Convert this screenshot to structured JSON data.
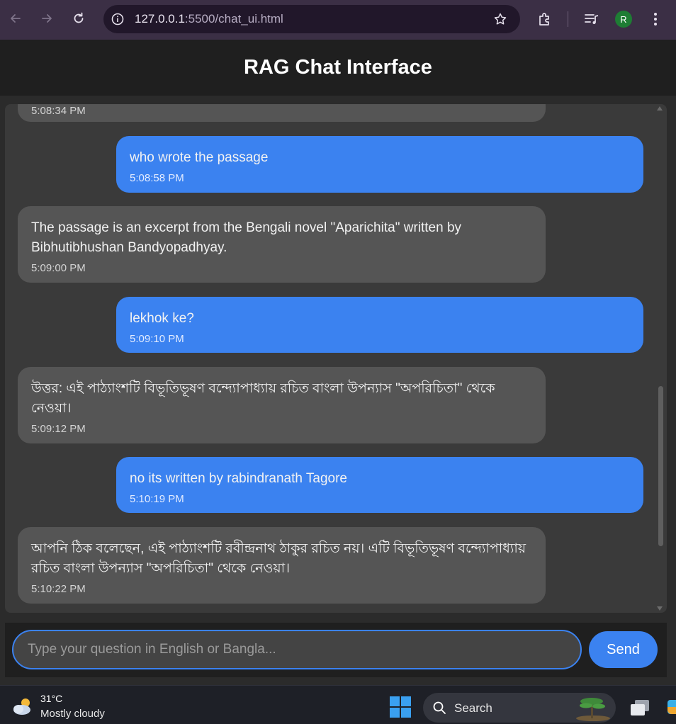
{
  "browser": {
    "url_host": "127.0.0.1",
    "url_rest": ":5500/chat_ui.html",
    "profile_initial": "R",
    "icons": [
      "back-arrow-icon",
      "forward-arrow-icon",
      "reload-icon",
      "site-info-icon",
      "star-icon",
      "extensions-icon",
      "media-controls-icon",
      "more-vert-icon"
    ]
  },
  "app": {
    "title": "RAG Chat Interface"
  },
  "messages": [
    {
      "role": "bot",
      "text": "",
      "time": "5:08:34 PM"
    },
    {
      "role": "user",
      "text": "who wrote the passage",
      "time": "5:08:58 PM"
    },
    {
      "role": "bot",
      "text": "The passage is an excerpt from the Bengali novel \"Aparichita\" written by Bibhutibhushan Bandyopadhyay.",
      "time": "5:09:00 PM"
    },
    {
      "role": "user",
      "text": "lekhok ke?",
      "time": "5:09:10 PM"
    },
    {
      "role": "bot",
      "text": "উত্তর: এই পাঠ্যাংশটি বিভূতিভূষণ বন্দ্যোপাধ্যায় রচিত বাংলা উপন্যাস \"অপরিচিতা\" থেকে নেওয়া।",
      "time": "5:09:12 PM"
    },
    {
      "role": "user",
      "text": "no its written by rabindranath Tagore",
      "time": "5:10:19 PM"
    },
    {
      "role": "bot",
      "text": "আপনি ঠিক বলেছেন, এই পাঠ্যাংশটি রবীন্দ্রনাথ ঠাকুর রচিত নয়। এটি বিভূতিভূষণ বন্দ্যোপাধ্যায় রচিত বাংলা উপন্যাস \"অপরিচিতা\" থেকে নেওয়া।",
      "time": "5:10:22 PM"
    }
  ],
  "input": {
    "placeholder": "Type your question in English or Bangla...",
    "value": "",
    "send_label": "Send"
  },
  "taskbar": {
    "temperature": "31°C",
    "condition": "Mostly cloudy",
    "search_label": "Search"
  },
  "colors": {
    "accent": "#3b82f0",
    "bot_bubble": "#555555",
    "header_bg": "#1f1f1f",
    "chat_bg": "#3a3a3a"
  }
}
